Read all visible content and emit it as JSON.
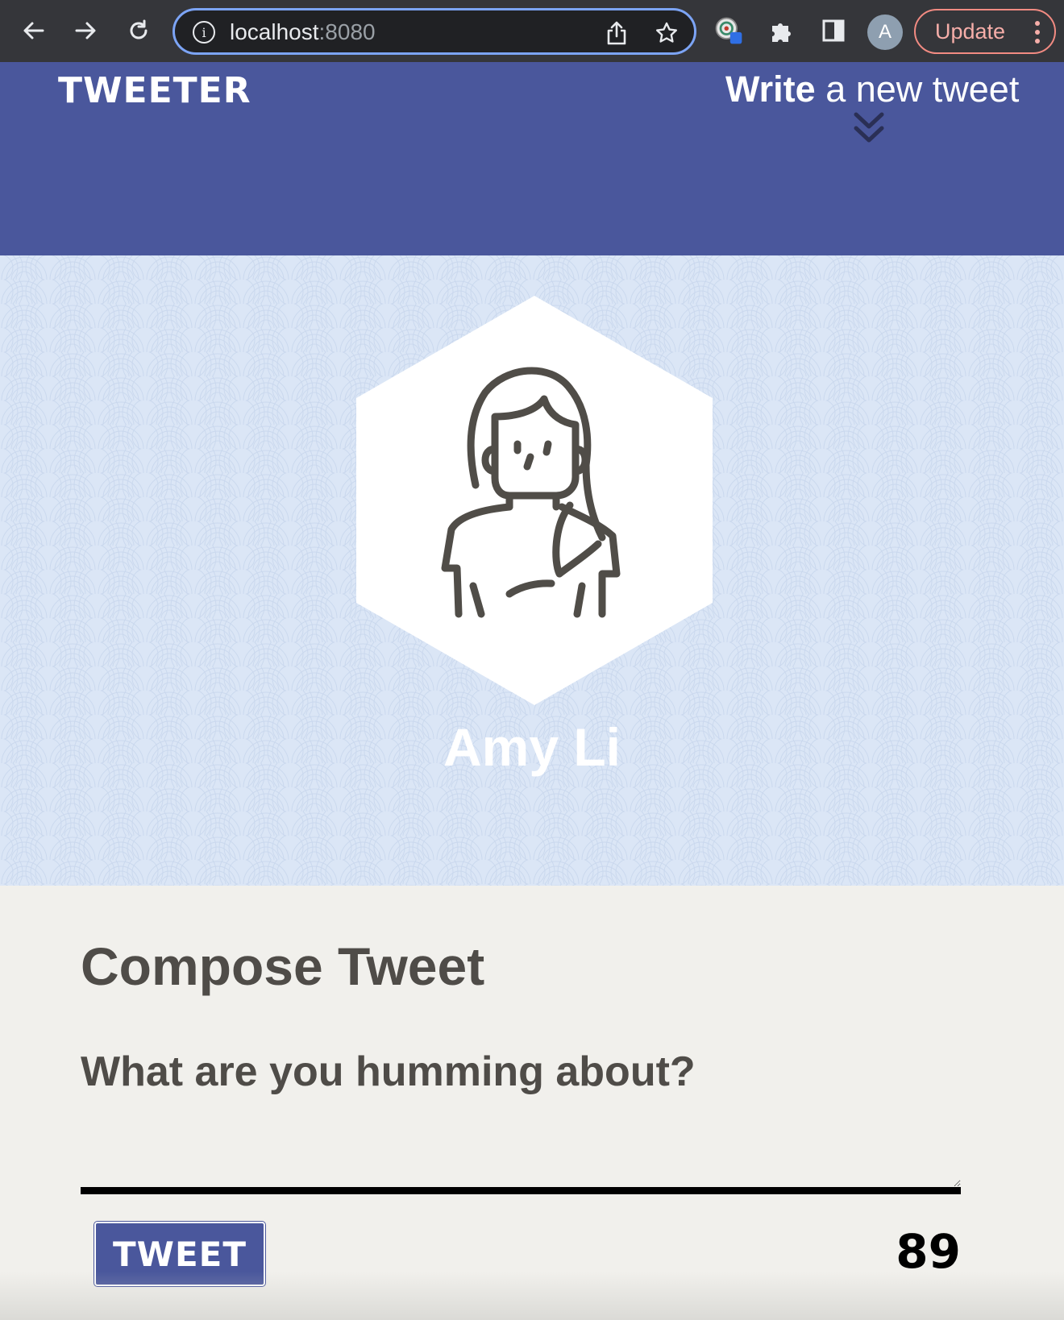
{
  "browser": {
    "url_host": "localhost",
    "url_port": ":8080",
    "profile_initial": "A",
    "update_label": "Update",
    "icons": [
      "back-icon",
      "forward-icon",
      "reload-icon",
      "site-info-icon",
      "share-icon",
      "bookmark-star-icon",
      "extension-badge-icon",
      "puzzle-icon",
      "side-panel-icon",
      "more-options-icon"
    ]
  },
  "nav": {
    "brand": "TWEETER",
    "write_bold": "Write",
    "write_rest": " a new tweet",
    "nav_color": "#4a579c"
  },
  "profile": {
    "name": "Amy Li",
    "background_color": "#dbe6f6",
    "avatar_icon": "woman-avatar-icon"
  },
  "compose": {
    "title": "Compose Tweet",
    "prompt": "What are you humming about?",
    "input_value": "",
    "button_label": "TWEET",
    "counter": "89"
  },
  "colors": {
    "accent": "#4a579c",
    "text_dark": "#4f4c48",
    "page_bg": "#f1f0ec",
    "update_border": "#f28b82"
  }
}
